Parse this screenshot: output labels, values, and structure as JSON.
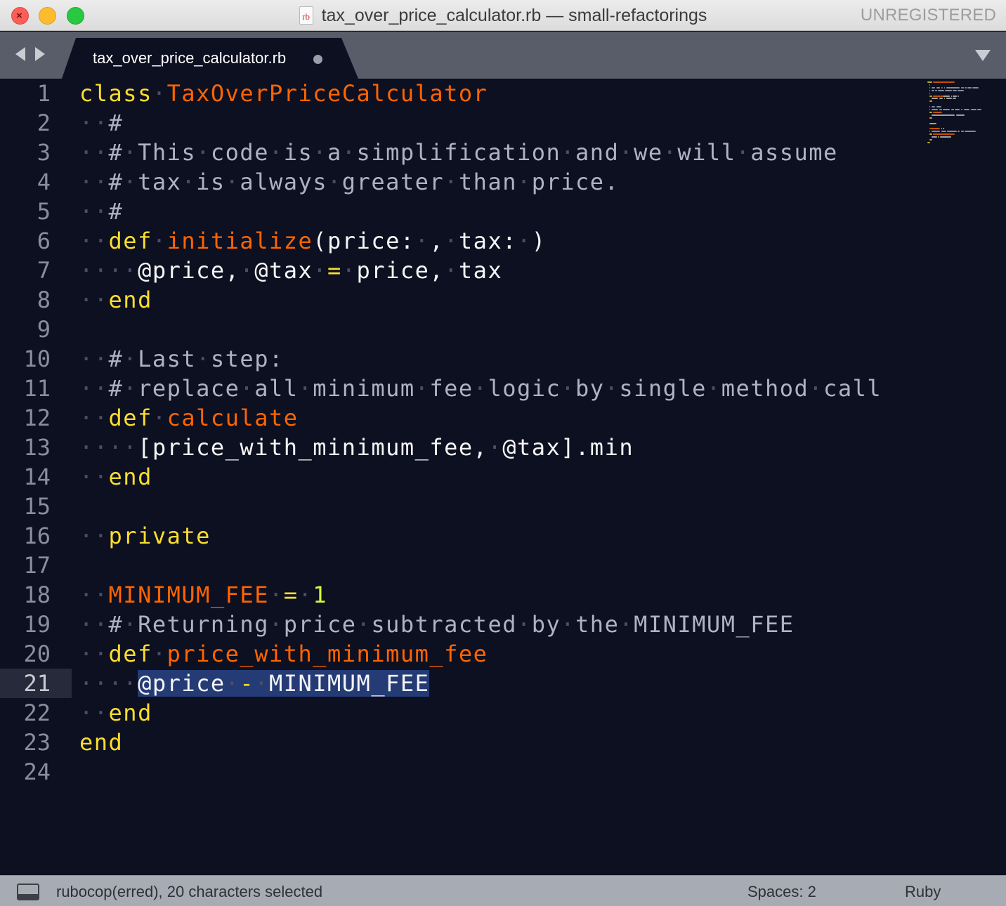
{
  "window": {
    "title": "tax_over_price_calculator.rb — small-refactorings",
    "file_icon_text": "rb",
    "registration": "UNREGISTERED"
  },
  "tabs": [
    {
      "label": "tax_over_price_calculator.rb",
      "dirty": true,
      "active": true
    }
  ],
  "editor": {
    "current_line": 21,
    "line_numbers": [
      "1",
      "2",
      "3",
      "4",
      "5",
      "6",
      "7",
      "8",
      "9",
      "10",
      "11",
      "12",
      "13",
      "14",
      "15",
      "16",
      "17",
      "18",
      "19",
      "20",
      "21",
      "22",
      "23",
      "24"
    ],
    "lines": [
      {
        "n": 1,
        "tokens": [
          {
            "t": "class",
            "c": "kw"
          },
          {
            "t": "·",
            "c": "ws"
          },
          {
            "t": "TaxOverPriceCalculator",
            "c": "cls"
          }
        ]
      },
      {
        "n": 2,
        "tokens": [
          {
            "t": "··",
            "c": "ws"
          },
          {
            "t": "#",
            "c": "cmt"
          }
        ]
      },
      {
        "n": 3,
        "tokens": [
          {
            "t": "··",
            "c": "ws"
          },
          {
            "t": "#",
            "c": "cmt"
          },
          {
            "t": "·",
            "c": "ws"
          },
          {
            "t": "This",
            "c": "cmt"
          },
          {
            "t": "·",
            "c": "ws"
          },
          {
            "t": "code",
            "c": "cmt"
          },
          {
            "t": "·",
            "c": "ws"
          },
          {
            "t": "is",
            "c": "cmt"
          },
          {
            "t": "·",
            "c": "ws"
          },
          {
            "t": "a",
            "c": "cmt"
          },
          {
            "t": "·",
            "c": "ws"
          },
          {
            "t": "simplification",
            "c": "cmt"
          },
          {
            "t": "·",
            "c": "ws"
          },
          {
            "t": "and",
            "c": "cmt"
          },
          {
            "t": "·",
            "c": "ws"
          },
          {
            "t": "we",
            "c": "cmt"
          },
          {
            "t": "·",
            "c": "ws"
          },
          {
            "t": "will",
            "c": "cmt"
          },
          {
            "t": "·",
            "c": "ws"
          },
          {
            "t": "assume",
            "c": "cmt"
          }
        ]
      },
      {
        "n": 4,
        "tokens": [
          {
            "t": "··",
            "c": "ws"
          },
          {
            "t": "#",
            "c": "cmt"
          },
          {
            "t": "·",
            "c": "ws"
          },
          {
            "t": "tax",
            "c": "cmt"
          },
          {
            "t": "·",
            "c": "ws"
          },
          {
            "t": "is",
            "c": "cmt"
          },
          {
            "t": "·",
            "c": "ws"
          },
          {
            "t": "always",
            "c": "cmt"
          },
          {
            "t": "·",
            "c": "ws"
          },
          {
            "t": "greater",
            "c": "cmt"
          },
          {
            "t": "·",
            "c": "ws"
          },
          {
            "t": "than",
            "c": "cmt"
          },
          {
            "t": "·",
            "c": "ws"
          },
          {
            "t": "price.",
            "c": "cmt"
          }
        ]
      },
      {
        "n": 5,
        "tokens": [
          {
            "t": "··",
            "c": "ws"
          },
          {
            "t": "#",
            "c": "cmt"
          }
        ]
      },
      {
        "n": 6,
        "tokens": [
          {
            "t": "··",
            "c": "ws"
          },
          {
            "t": "def",
            "c": "kw"
          },
          {
            "t": "·",
            "c": "ws"
          },
          {
            "t": "initialize",
            "c": "fn"
          },
          {
            "t": "(price:",
            "c": ""
          },
          {
            "t": "·",
            "c": "ws"
          },
          {
            "t": ",",
            "c": ""
          },
          {
            "t": "·",
            "c": "ws"
          },
          {
            "t": "tax:",
            "c": ""
          },
          {
            "t": "·",
            "c": "ws"
          },
          {
            "t": ")",
            "c": ""
          }
        ]
      },
      {
        "n": 7,
        "tokens": [
          {
            "t": "····",
            "c": "ws"
          },
          {
            "t": "@price,",
            "c": ""
          },
          {
            "t": "·",
            "c": "ws"
          },
          {
            "t": "@tax",
            "c": ""
          },
          {
            "t": "·",
            "c": "ws"
          },
          {
            "t": "=",
            "c": "op"
          },
          {
            "t": "·",
            "c": "ws"
          },
          {
            "t": "price,",
            "c": ""
          },
          {
            "t": "·",
            "c": "ws"
          },
          {
            "t": "tax",
            "c": ""
          }
        ]
      },
      {
        "n": 8,
        "tokens": [
          {
            "t": "··",
            "c": "ws"
          },
          {
            "t": "end",
            "c": "kw"
          }
        ]
      },
      {
        "n": 9,
        "tokens": []
      },
      {
        "n": 10,
        "tokens": [
          {
            "t": "··",
            "c": "ws"
          },
          {
            "t": "#",
            "c": "cmt"
          },
          {
            "t": "·",
            "c": "ws"
          },
          {
            "t": "Last",
            "c": "cmt"
          },
          {
            "t": "·",
            "c": "ws"
          },
          {
            "t": "step:",
            "c": "cmt"
          }
        ]
      },
      {
        "n": 11,
        "tokens": [
          {
            "t": "··",
            "c": "ws"
          },
          {
            "t": "#",
            "c": "cmt"
          },
          {
            "t": "·",
            "c": "ws"
          },
          {
            "t": "replace",
            "c": "cmt"
          },
          {
            "t": "·",
            "c": "ws"
          },
          {
            "t": "all",
            "c": "cmt"
          },
          {
            "t": "·",
            "c": "ws"
          },
          {
            "t": "minimum",
            "c": "cmt"
          },
          {
            "t": "·",
            "c": "ws"
          },
          {
            "t": "fee",
            "c": "cmt"
          },
          {
            "t": "·",
            "c": "ws"
          },
          {
            "t": "logic",
            "c": "cmt"
          },
          {
            "t": "·",
            "c": "ws"
          },
          {
            "t": "by",
            "c": "cmt"
          },
          {
            "t": "·",
            "c": "ws"
          },
          {
            "t": "single",
            "c": "cmt"
          },
          {
            "t": "·",
            "c": "ws"
          },
          {
            "t": "method",
            "c": "cmt"
          },
          {
            "t": "·",
            "c": "ws"
          },
          {
            "t": "call",
            "c": "cmt"
          }
        ]
      },
      {
        "n": 12,
        "tokens": [
          {
            "t": "··",
            "c": "ws"
          },
          {
            "t": "def",
            "c": "kw"
          },
          {
            "t": "·",
            "c": "ws"
          },
          {
            "t": "calculate",
            "c": "fn"
          }
        ]
      },
      {
        "n": 13,
        "tokens": [
          {
            "t": "····",
            "c": "ws"
          },
          {
            "t": "[price_with_minimum_fee,",
            "c": ""
          },
          {
            "t": "·",
            "c": "ws"
          },
          {
            "t": "@tax].min",
            "c": ""
          }
        ]
      },
      {
        "n": 14,
        "tokens": [
          {
            "t": "··",
            "c": "ws"
          },
          {
            "t": "end",
            "c": "kw"
          }
        ]
      },
      {
        "n": 15,
        "tokens": []
      },
      {
        "n": 16,
        "tokens": [
          {
            "t": "··",
            "c": "ws"
          },
          {
            "t": "private",
            "c": "kw"
          }
        ]
      },
      {
        "n": 17,
        "tokens": []
      },
      {
        "n": 18,
        "tokens": [
          {
            "t": "··",
            "c": "ws"
          },
          {
            "t": "MINIMUM_FEE",
            "c": "cls"
          },
          {
            "t": "·",
            "c": "ws"
          },
          {
            "t": "=",
            "c": "op"
          },
          {
            "t": "·",
            "c": "ws"
          },
          {
            "t": "1",
            "c": "num"
          }
        ]
      },
      {
        "n": 19,
        "tokens": [
          {
            "t": "··",
            "c": "ws"
          },
          {
            "t": "#",
            "c": "cmt"
          },
          {
            "t": "·",
            "c": "ws"
          },
          {
            "t": "Returning",
            "c": "cmt"
          },
          {
            "t": "·",
            "c": "ws"
          },
          {
            "t": "price",
            "c": "cmt"
          },
          {
            "t": "·",
            "c": "ws"
          },
          {
            "t": "subtracted",
            "c": "cmt"
          },
          {
            "t": "·",
            "c": "ws"
          },
          {
            "t": "by",
            "c": "cmt"
          },
          {
            "t": "·",
            "c": "ws"
          },
          {
            "t": "the",
            "c": "cmt"
          },
          {
            "t": "·",
            "c": "ws"
          },
          {
            "t": "MINIMUM_FEE",
            "c": "cmt"
          }
        ]
      },
      {
        "n": 20,
        "tokens": [
          {
            "t": "··",
            "c": "ws"
          },
          {
            "t": "def",
            "c": "kw"
          },
          {
            "t": "·",
            "c": "ws"
          },
          {
            "t": "price_with_minimum_fee",
            "c": "fn"
          }
        ]
      },
      {
        "n": 21,
        "tokens": [
          {
            "t": "····",
            "c": "ws"
          },
          {
            "t": "@price",
            "c": "sel"
          },
          {
            "t": "·",
            "c": "ws sel"
          },
          {
            "t": "-",
            "c": "op sel"
          },
          {
            "t": "·",
            "c": "ws sel"
          },
          {
            "t": "MINIMUM_FEE",
            "c": "sel"
          }
        ]
      },
      {
        "n": 22,
        "tokens": [
          {
            "t": "··",
            "c": "ws"
          },
          {
            "t": "end",
            "c": "kw"
          }
        ]
      },
      {
        "n": 23,
        "tokens": [
          {
            "t": "end",
            "c": "kw"
          }
        ]
      },
      {
        "n": 24,
        "tokens": []
      }
    ]
  },
  "status_bar": {
    "message": "rubocop(erred), 20 characters selected",
    "indentation": "Spaces: 2",
    "syntax": "Ruby"
  },
  "colors": {
    "background": "#0d1021",
    "keyword": "#fbde2d",
    "class_and_function": "#ff6400",
    "comment": "#aeb2c3",
    "number": "#d8fa3c",
    "selection": "#253b76",
    "whitespace_dot": "#4a4f63"
  }
}
